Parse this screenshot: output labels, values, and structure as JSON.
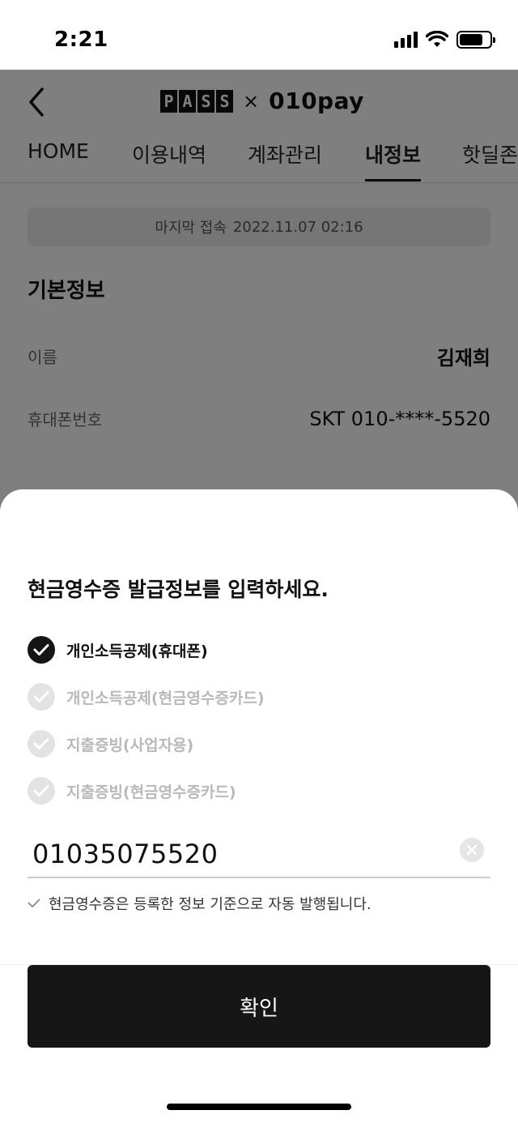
{
  "status_bar": {
    "time": "2:21"
  },
  "header": {
    "brand_pass": [
      "P",
      "A",
      "S",
      "S"
    ],
    "brand_x": "×",
    "brand_pay": "010pay"
  },
  "tabs": [
    {
      "label": "HOME",
      "active": false
    },
    {
      "label": "이용내역",
      "active": false
    },
    {
      "label": "계좌관리",
      "active": false
    },
    {
      "label": "내정보",
      "active": true
    },
    {
      "label": "핫딜존",
      "active": false
    }
  ],
  "last_login": {
    "label": "마지막 접속",
    "value": "2022.11.07 02:16"
  },
  "basic_info": {
    "title": "기본정보",
    "name_label": "이름",
    "name_value": "김재희",
    "phone_label": "휴대폰번호",
    "phone_value": "SKT 010-****-5520"
  },
  "sheet": {
    "title": "현금영수증 발급정보를 입력하세요.",
    "options": [
      {
        "label": "개인소득공제(휴대폰)",
        "selected": true
      },
      {
        "label": "개인소득공제(현금영수증카드)",
        "selected": false
      },
      {
        "label": "지출증빙(사업자용)",
        "selected": false
      },
      {
        "label": "지출증빙(현금영수증카드)",
        "selected": false
      }
    ],
    "input_value": "01035075520",
    "note": "현금영수증은 등록한 정보 기준으로 자동 발행됩니다.",
    "confirm_label": "확인"
  },
  "icons": {
    "back": "chevron-left-icon",
    "check": "checkmark-icon",
    "clear": "clear-x-icon",
    "note": "small-check-icon"
  }
}
